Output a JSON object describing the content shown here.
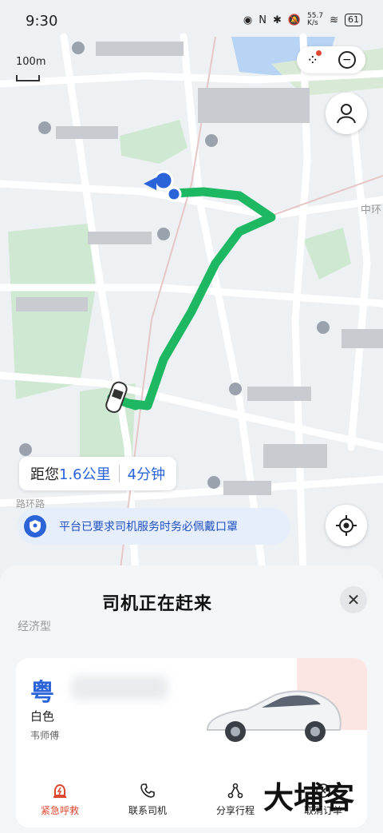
{
  "status_bar": {
    "time": "9:30",
    "speed": "55.7\nK/s",
    "battery": "61"
  },
  "map": {
    "scale_label": "100m",
    "road_label": "中环",
    "road_label_2": "路环路"
  },
  "trip": {
    "distance_prefix": "距您",
    "distance": "1.6公里",
    "eta": "4分钟",
    "notice": "平台已要求司机服务时务必佩戴口罩"
  },
  "sheet": {
    "title": "司机正在赶来",
    "car_type": "经济型",
    "plate_prefix": "粤",
    "car_color": "白色",
    "driver_name": "韦师傅",
    "actions": [
      {
        "label": "紧急呼救",
        "icon": "alarm-icon"
      },
      {
        "label": "联系司机",
        "icon": "phone-icon"
      },
      {
        "label": "分享行程",
        "icon": "share-icon"
      },
      {
        "label": "取消订单",
        "icon": "cancel-icon"
      }
    ]
  },
  "watermark": "大埔客",
  "colors": {
    "route": "#1fb862",
    "accent": "#2a64d8",
    "emergency": "#e0472f"
  }
}
